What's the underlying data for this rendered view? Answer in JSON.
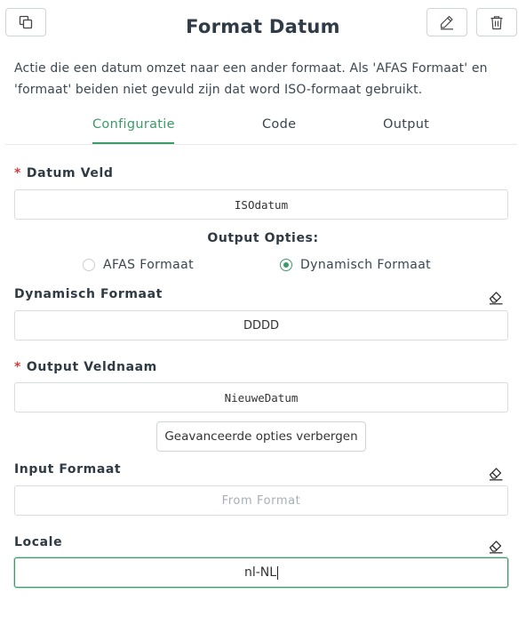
{
  "header": {
    "title": "Format Datum",
    "description": "Actie die een datum omzet naar een ander formaat. Als 'AFAS Formaat' en 'formaat' beiden niet gevuld zijn dat word ISO-formaat gebruikt."
  },
  "tabs": [
    {
      "label": "Configuratie",
      "active": true
    },
    {
      "label": "Code",
      "active": false
    },
    {
      "label": "Output",
      "active": false
    }
  ],
  "form": {
    "datum_veld": {
      "label": "Datum Veld",
      "required": true,
      "value": "ISOdatum"
    },
    "output_opties": {
      "label": "Output Opties:",
      "options": [
        {
          "label": "AFAS Formaat",
          "selected": false
        },
        {
          "label": "Dynamisch Formaat",
          "selected": true
        }
      ]
    },
    "dynamisch_formaat": {
      "label": "Dynamisch Formaat",
      "value": "DDDD"
    },
    "output_veldnaam": {
      "label": "Output Veldnaam",
      "required": true,
      "value": "NieuweDatum"
    },
    "advanced_button": "Geavanceerde opties verbergen",
    "input_formaat": {
      "label": "Input Formaat",
      "value": "",
      "placeholder": "From Format"
    },
    "locale": {
      "label": "Locale",
      "value": "nl-NL"
    },
    "required_marker": "*"
  },
  "colors": {
    "accent": "#3c9a68",
    "required": "#d23b3b"
  },
  "icons": [
    "duplicate-icon",
    "pencil-icon",
    "trash-icon",
    "eraser-icon"
  ]
}
